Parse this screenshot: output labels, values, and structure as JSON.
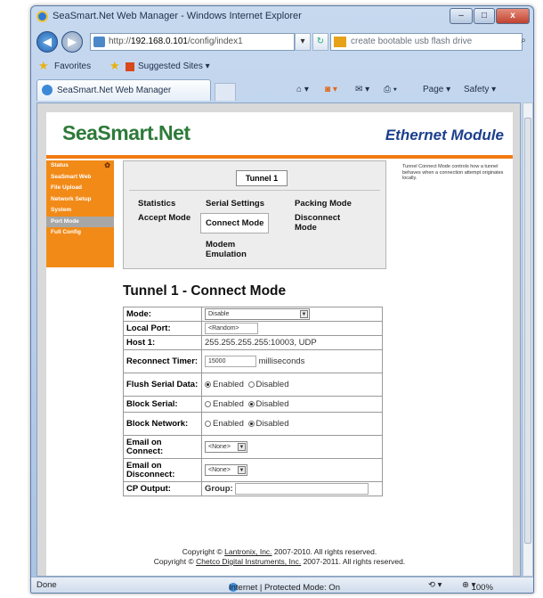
{
  "window": {
    "title": "SeaSmart.Net Web Manager - Windows Internet Explorer",
    "minimize_glyph": "–",
    "maximize_glyph": "□",
    "close_glyph": "x"
  },
  "navbar": {
    "address_prefix": "http://",
    "address_host": "192.168.0.101",
    "address_path": "/config/index1",
    "search_placeholder": "create bootable usb flash drive",
    "search_icon": "search-icon"
  },
  "favorites_bar": {
    "favorites_label": "Favorites",
    "suggested_sites_label": "Suggested Sites ▾"
  },
  "tab": {
    "title": "SeaSmart.Net Web Manager"
  },
  "command_bar": {
    "page_label": "Page ▾",
    "safety_label": "Safety ▾"
  },
  "header": {
    "logo_text": "SeaSmart.Net",
    "module_title": "Ethernet Module"
  },
  "sidenav": {
    "items": [
      {
        "label": "Status"
      },
      {
        "label": "SeaSmart Web"
      },
      {
        "label": "File Upload"
      },
      {
        "label": "Network Setup"
      },
      {
        "label": "System"
      },
      {
        "label": "Port Mode"
      },
      {
        "label": "Full Config"
      }
    ],
    "active_index": 5
  },
  "help_text": "Tunnel Connect Mode controls how a tunnel behaves when a connection attempt originates locally.",
  "tunnel_selector": "Tunnel 1",
  "tunnel_tabs": {
    "statistics": "Statistics",
    "serial_settings": "Serial Settings",
    "packing_mode": "Packing Mode",
    "accept_mode": "Accept Mode",
    "connect_mode": "Connect Mode",
    "disconnect_mode": "Disconnect Mode",
    "modem_emulation": "Modem Emulation"
  },
  "section_title": "Tunnel 1 - Connect Mode",
  "form": {
    "mode_label": "Mode:",
    "mode_value": "Disable",
    "local_port_label": "Local Port:",
    "local_port_value": "<Random>",
    "host1_label": "Host 1:",
    "host1_value": "255.255.255.255:10003, UDP",
    "reconnect_label": "Reconnect Timer:",
    "reconnect_value": "15000",
    "reconnect_unit": "milliseconds",
    "flush_label": "Flush Serial Data:",
    "flush_enabled": "Enabled",
    "flush_disabled": "Disabled",
    "block_serial_label": "Block Serial:",
    "block_serial_enabled": "Enabled",
    "block_serial_disabled": "Disabled",
    "block_network_label": "Block Network:",
    "block_network_enabled": "Enabled",
    "block_network_disabled": "Disabled",
    "email_connect_label": "Email on Connect:",
    "email_connect_value": "<None>",
    "email_disconnect_label": "Email on Disconnect:",
    "email_disconnect_value": "<None>",
    "cp_output_label": "CP Output:",
    "group_label": "Group:"
  },
  "footer": {
    "line1_prefix": "Copyright © ",
    "line1_link": "Lantronix, Inc.",
    "line1_suffix": " 2007-2010. All rights reserved.",
    "line2_prefix": "Copyright © ",
    "line2_link": "Chetco Digital Instruments, Inc.",
    "line2_suffix": " 2007-2011. All rights reserved."
  },
  "statusbar": {
    "left": "Done",
    "zone": "Internet | Protected Mode: On",
    "zoom": "100%"
  }
}
